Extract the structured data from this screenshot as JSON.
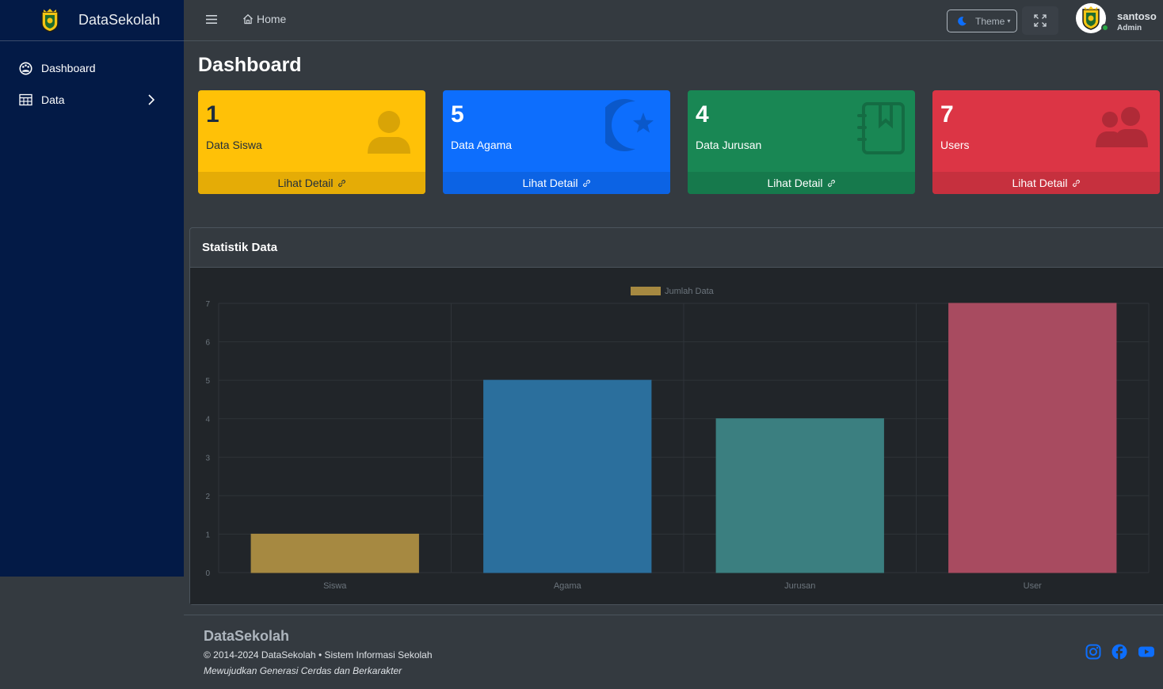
{
  "brand": {
    "name": "DataSekolah"
  },
  "sidebar": {
    "items": [
      {
        "label": "Dashboard",
        "icon": "palette-icon"
      },
      {
        "label": "Data",
        "icon": "table-icon"
      }
    ]
  },
  "topbar": {
    "home_label": "Home",
    "theme_label": "Theme",
    "user": {
      "name": "santoso",
      "role": "Admin"
    }
  },
  "page": {
    "title": "Dashboard"
  },
  "stat_boxes": [
    {
      "count": "1",
      "label": "Data Siswa",
      "link": "Lihat Detail",
      "color": "#ffc107",
      "icon": "person-icon"
    },
    {
      "count": "5",
      "label": "Data Agama",
      "link": "Lihat Detail",
      "color": "#0d6efd",
      "icon": "star-crescent-icon"
    },
    {
      "count": "4",
      "label": "Data Jurusan",
      "link": "Lihat Detail",
      "color": "#198754",
      "icon": "journal-bookmark-icon"
    },
    {
      "count": "7",
      "label": "Users",
      "link": "Lihat Detail",
      "color": "#dc3545",
      "icon": "people-icon"
    }
  ],
  "card": {
    "title": "Statistik Data"
  },
  "chart_data": {
    "type": "bar",
    "categories": [
      "Siswa",
      "Agama",
      "Jurusan",
      "User"
    ],
    "series": [
      {
        "name": "Jumlah Data",
        "values": [
          1,
          5,
          4,
          7
        ]
      }
    ],
    "colors": [
      "#a68941",
      "#2b6f9d",
      "#3b7f80",
      "#a84b60"
    ],
    "ylim": [
      0,
      7
    ],
    "yticks": [
      0,
      1,
      2,
      3,
      4,
      5,
      6,
      7
    ],
    "grid": true,
    "legend": "top"
  },
  "footer": {
    "brand": "DataSekolah",
    "copyright": "© 2014-2024 DataSekolah • Sistem Informasi Sekolah",
    "tagline": "Mewujudkan Generasi Cerdas dan Berkarakter"
  }
}
